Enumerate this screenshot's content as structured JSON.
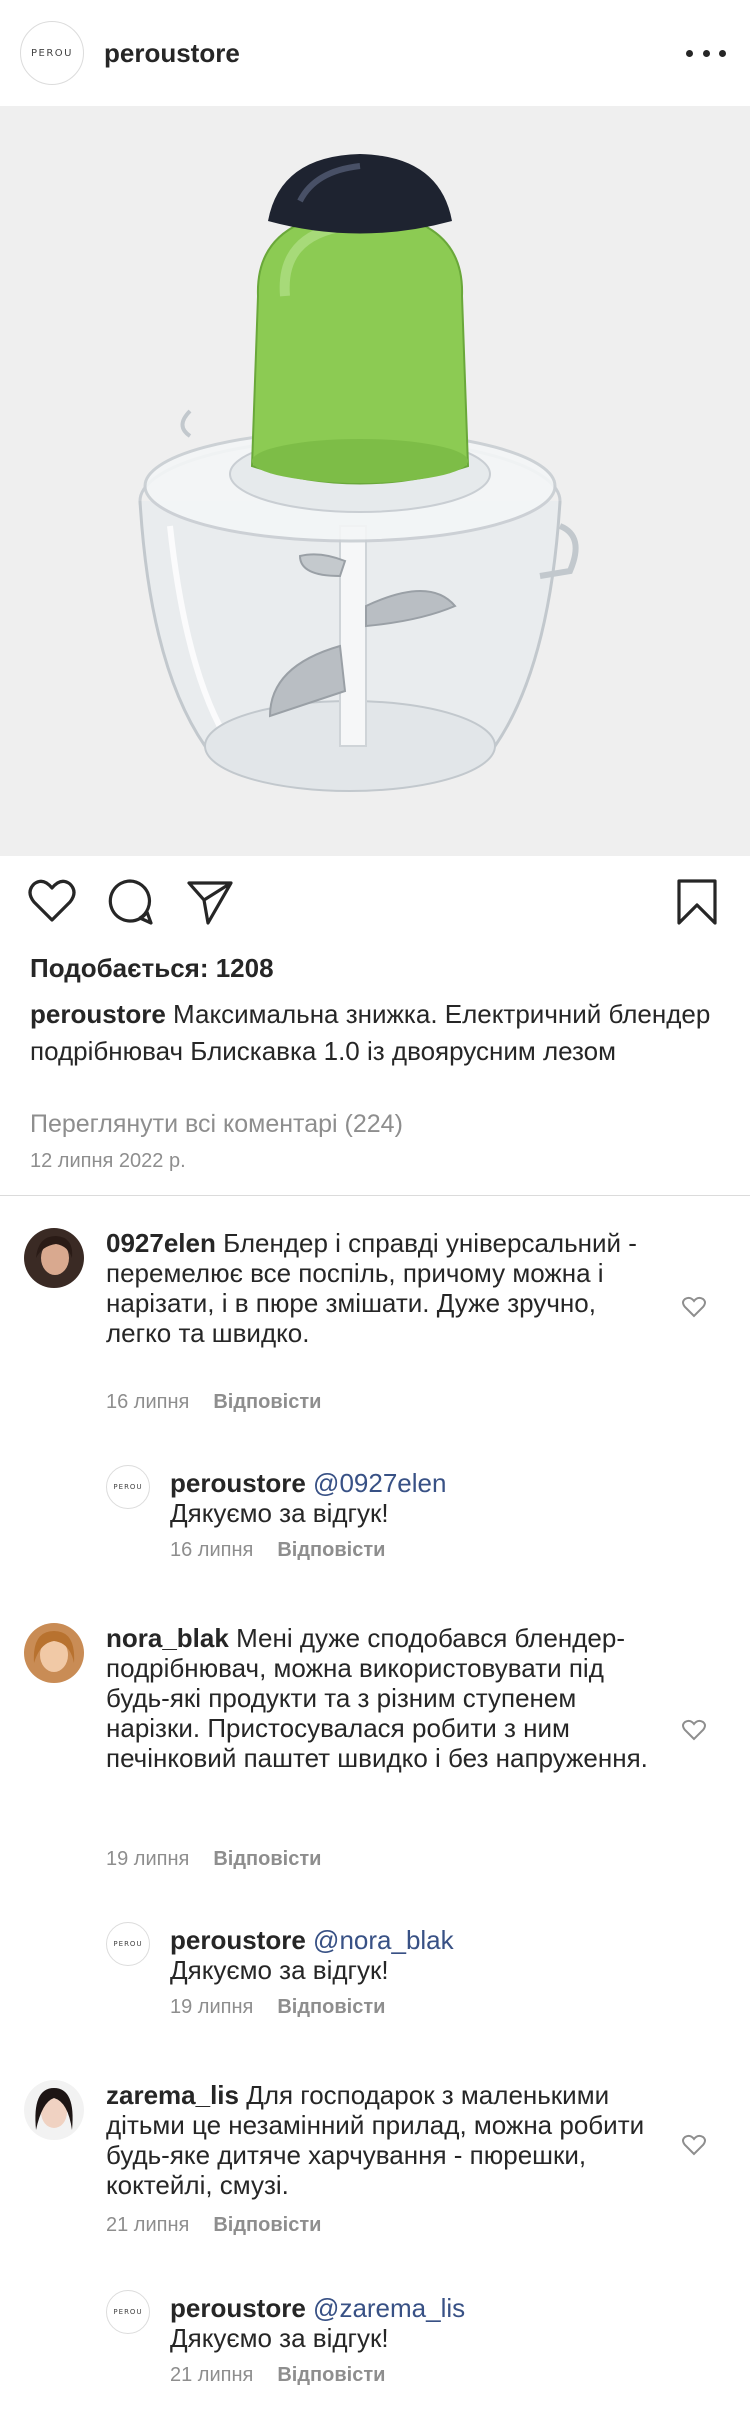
{
  "header": {
    "username": "peroustore",
    "avatar_text": "PEROU",
    "more_icon": "more-dots-icon"
  },
  "post": {
    "image_alt": "green electric blender chopper with transparent bowl",
    "likes_text": "Подобається: 1208",
    "caption_user": "peroustore",
    "caption_text": "Максимальна знижка. Електричний блендер подрібнювач Блискавка 1.0 із двоярусним лезом",
    "view_all": "Переглянути всі коментарі (224)",
    "date": "12 липня 2022 р."
  },
  "comments": [
    {
      "user": "0927elen",
      "text": "Блендер і справді універсальний - перемелює все поспіль, причому можна і нарізати, і в пюре змішати. Дуже зручно, легко та швидко.",
      "date": "16 липня",
      "reply_label": "Відповісти",
      "reply": {
        "user": "peroustore",
        "mention": "@0927elen",
        "text": "Дякуємо за відгук!",
        "date": "16 липня",
        "reply_label": "Відповісти",
        "avatar_text": "PEROU"
      }
    },
    {
      "user": "nora_blak",
      "text": "Мені дуже сподобався блендер-подрібнювач, можна використовувати під будь-які продукти та з різним ступенем нарізки. Пристосувалася робити з ним печінковий паштет швидко і без напруження.",
      "date": "19 липня",
      "reply_label": "Відповісти",
      "reply": {
        "user": "peroustore",
        "mention": "@nora_blak",
        "text": "Дякуємо за відгук!",
        "date": "19 липня",
        "reply_label": "Відповісти",
        "avatar_text": "PEROU"
      }
    },
    {
      "user": "zarema_lis",
      "text": "Для господарок з маленькими дітьми це незамінний прилад, можна робити будь-яке дитяче харчування - пюрешки, коктейлі, смузі.",
      "date": "21 липня",
      "reply_label": "Відповісти",
      "reply": {
        "user": "peroustore",
        "mention": "@zarema_lis",
        "text": "Дякуємо за відгук!",
        "date": "21 липня",
        "reply_label": "Відповісти",
        "avatar_text": "PEROU"
      }
    }
  ]
}
